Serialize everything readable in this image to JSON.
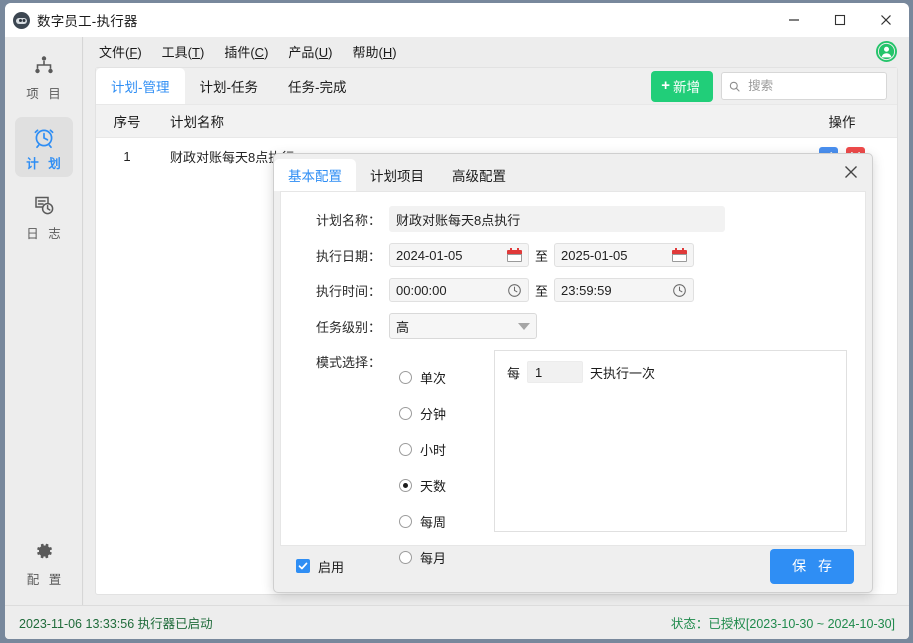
{
  "window": {
    "title": "数字员工-执行器",
    "app_icon": "robot-icon",
    "controls": {
      "minimize": "minimize-icon",
      "maximize": "maximize-icon",
      "close": "close-icon"
    }
  },
  "sidebar": {
    "items": [
      {
        "label": "项 目",
        "icon": "sitemap-icon",
        "active": false
      },
      {
        "label": "计 划",
        "icon": "alarm-clock-icon",
        "active": true
      },
      {
        "label": "日 志",
        "icon": "log-clock-icon",
        "active": false
      }
    ],
    "bottom": {
      "label": "配 置",
      "icon": "gear-icon"
    }
  },
  "menubar": {
    "items": [
      {
        "text": "文件",
        "mnemonic": "F"
      },
      {
        "text": "工具",
        "mnemonic": "T"
      },
      {
        "text": "插件",
        "mnemonic": "C"
      },
      {
        "text": "产品",
        "mnemonic": "U"
      },
      {
        "text": "帮助",
        "mnemonic": "H"
      }
    ],
    "avatar": "user-avatar-icon"
  },
  "main": {
    "tabs": [
      {
        "label": "计划-管理",
        "active": true
      },
      {
        "label": "计划-任务",
        "active": false
      },
      {
        "label": "任务-完成",
        "active": false
      }
    ],
    "toolbar": {
      "add_label": "新增",
      "add_plus": "+",
      "add_color": "#21ce79"
    },
    "search": {
      "placeholder": "搜索",
      "value": "",
      "icon": "search-icon"
    },
    "table": {
      "columns": [
        "序号",
        "计划名称",
        "操作"
      ],
      "rows": [
        {
          "index": "1",
          "name": "财政对账每天8点执行",
          "ops": [
            "edit-icon",
            "delete-icon"
          ]
        }
      ]
    }
  },
  "dialog": {
    "tabs": [
      {
        "label": "基本配置",
        "active": true
      },
      {
        "label": "计划项目",
        "active": false
      },
      {
        "label": "高级配置",
        "active": false
      }
    ],
    "close_icon": "close-icon",
    "fields": {
      "plan_name": {
        "label": "计划名称：",
        "value": "财政对账每天8点执行"
      },
      "exec_date": {
        "label": "执行日期：",
        "start": "2024-01-05",
        "end": "2025-01-05",
        "separator": "至",
        "icon": "calendar-icon"
      },
      "exec_time": {
        "label": "执行时间：",
        "start": "00:00:00",
        "end": "23:59:59",
        "separator": "至",
        "icon": "clock-icon"
      },
      "task_level": {
        "label": "任务级别：",
        "value": "高",
        "icon": "chevron-down-icon"
      }
    },
    "mode": {
      "label": "模式选择：",
      "options": [
        {
          "label": "单次",
          "selected": false
        },
        {
          "label": "分钟",
          "selected": false
        },
        {
          "label": "小时",
          "selected": false
        },
        {
          "label": "天数",
          "selected": true
        },
        {
          "label": "每周",
          "selected": false
        },
        {
          "label": "每月",
          "selected": false
        }
      ],
      "panel": {
        "prefix": "每",
        "value": "1",
        "suffix": "天执行一次"
      }
    },
    "footer": {
      "enable_label": "启用",
      "enable_checked": true,
      "save_label": "保 存",
      "save_color": "#2f8ef4"
    }
  },
  "statusbar": {
    "left": "2023-11-06 13:33:56 执行器已启动",
    "right": "状态：已授权[2023-10-30 ~ 2024-10-30]"
  }
}
